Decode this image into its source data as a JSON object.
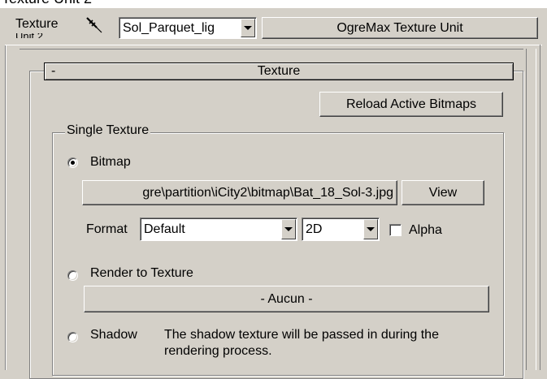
{
  "window": {
    "title_fragment": "Texture Unit 2"
  },
  "toolbar": {
    "label": "Texture",
    "label_second_line": "Unit 2",
    "eyedropper_icon": "eyedropper-icon",
    "material_select_value": "Sol_Parquet_lig",
    "type_button_label": "OgreMax Texture Unit"
  },
  "rollout": {
    "collapse_symbol": "-",
    "title": "Texture",
    "reload_button_label": "Reload Active Bitmaps"
  },
  "single_texture": {
    "group_label": "Single Texture",
    "bitmap": {
      "radio_label": "Bitmap",
      "selected": true,
      "path_value": "gre\\partition\\iCity2\\bitmap\\Bat_18_Sol-3.jpg",
      "view_button_label": "View",
      "format_label": "Format",
      "format_value": "Default",
      "dimension_value": "2D",
      "alpha_label": "Alpha",
      "alpha_checked": false
    },
    "render_to_texture": {
      "radio_label": "Render to Texture",
      "selected": false,
      "button_label": "- Aucun -"
    },
    "shadow": {
      "radio_label": "Shadow",
      "selected": false,
      "description": "The shadow texture will be passed in during the rendering process."
    }
  }
}
